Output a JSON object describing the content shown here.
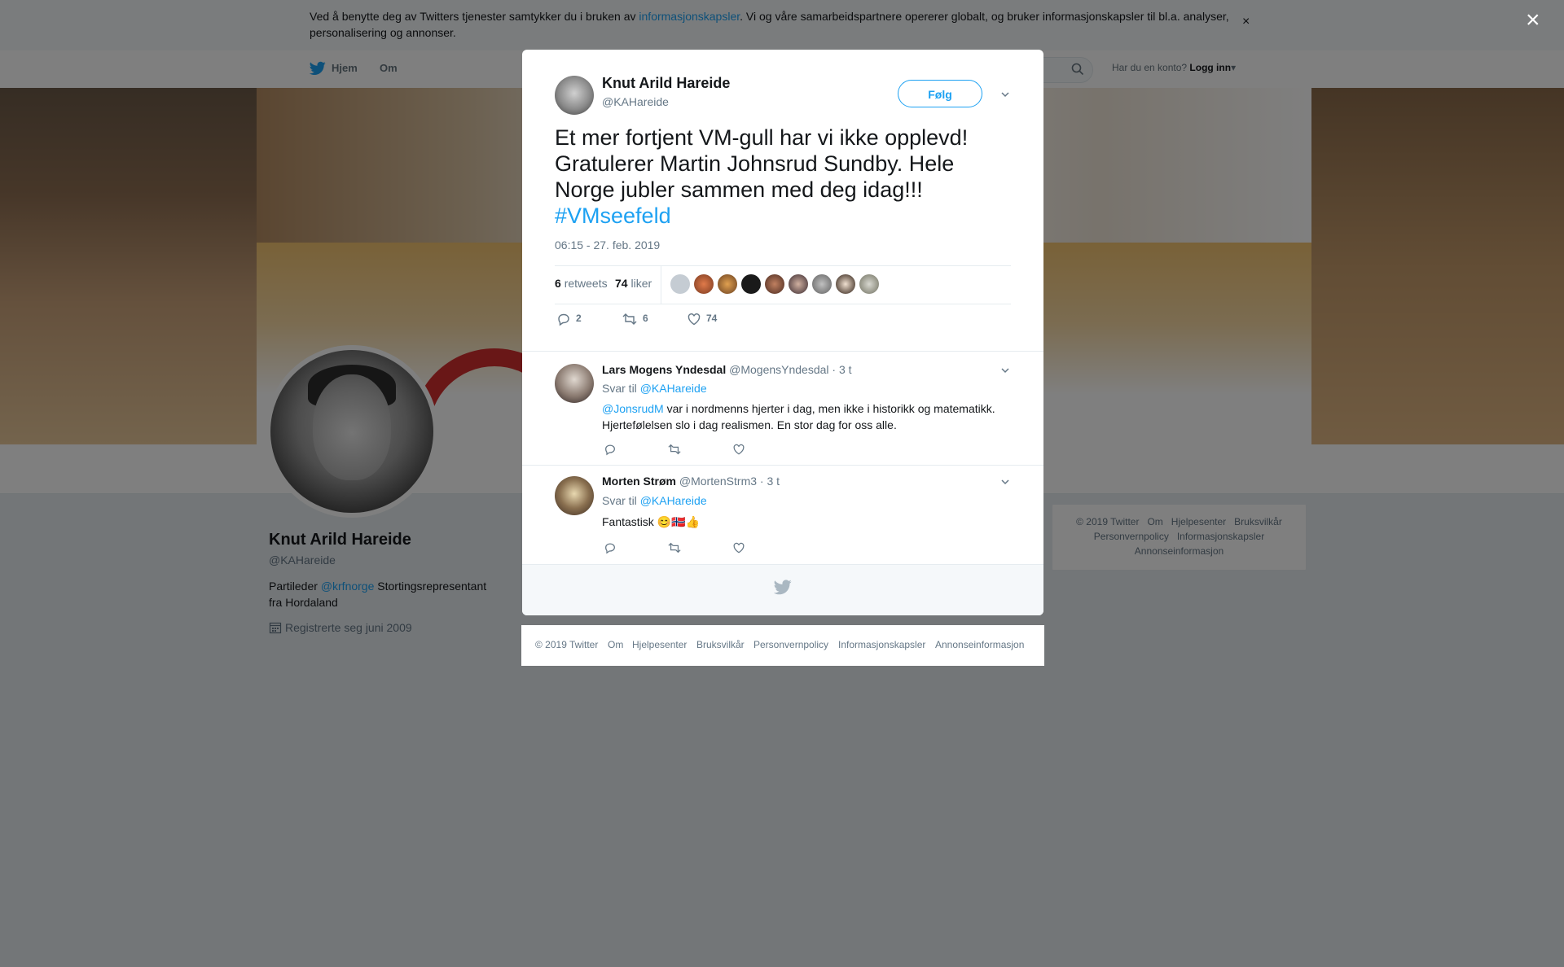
{
  "cookie": {
    "text_before": "Ved å benytte deg av Twitters tjenester samtykker du i bruken av ",
    "link": "informasjonskapsler",
    "text_after": ". Vi og våre samarbeidspartnere opererer globalt, og bruker informasjonskapsler til bl.a. analyser, personalisering og annonser.",
    "close": "×"
  },
  "nav": {
    "home": "Hjem",
    "about": "Om",
    "have_account": "Har du en konto?",
    "login": "Logg inn"
  },
  "profile": {
    "name": "Knut Arild Hareide",
    "handle": "@KAHareide",
    "bio_before": "Partileder ",
    "bio_link": "@krfnorge",
    "bio_after": " Stortingsrepresentant fra Hordaland",
    "joined": "Registrerte seg juni 2009"
  },
  "side_footer": {
    "items_row1": [
      "© 2019 Twitter",
      "Om",
      "Hjelpesenter",
      "Bruksvilkår"
    ],
    "items_row2": [
      "Personvernpolicy",
      "Informasjonskapsler"
    ],
    "items_row3": [
      "Annonseinformasjon"
    ]
  },
  "overlay_close": "×",
  "tweet": {
    "author_name": "Knut Arild Hareide",
    "author_handle": "@KAHareide",
    "follow_label": "Følg",
    "text": "Et mer fortjent VM-gull har vi ikke opplevd! Gratulerer Martin Johnsrud Sundby. Hele Norge jubler sammen med deg idag!!!",
    "hashtag": "#VMseefeld",
    "timestamp": "06:15 - 27. feb. 2019",
    "retweets_count": "6",
    "retweets_label": "retweets",
    "likes_count": "74",
    "likes_label": "liker",
    "reply_count": "2",
    "retweet_count_action": "6",
    "like_count_action": "74"
  },
  "replies": [
    {
      "name": "Lars Mogens Yndesdal",
      "handle": "@MogensYndesdal",
      "time": "· 3 t",
      "reply_to_label": "Svar til",
      "reply_to": "@KAHareide",
      "mention": "@JonsrudM",
      "text": " var i nordmenns hjerter i dag, men ikke i historikk og matematikk. Hjertefølelsen slo i dag realismen. En stor dag for oss alle."
    },
    {
      "name": "Morten Strøm",
      "handle": "@MortenStrm3",
      "time": "· 3 t",
      "reply_to_label": "Svar til",
      "reply_to": "@KAHareide",
      "text": "Fantastisk 😊🇳🇴👍"
    }
  ],
  "modal_footer": {
    "items": [
      "© 2019 Twitter",
      "Om",
      "Hjelpesenter",
      "Bruksvilkår",
      "Personvernpolicy",
      "Informasjonskapsler",
      "Annonseinformasjon"
    ]
  },
  "colors": {
    "accent": "#1da1f2",
    "background": "#e6ecf0",
    "text_secondary": "#657786"
  }
}
